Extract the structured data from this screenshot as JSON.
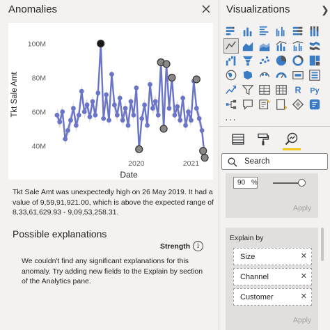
{
  "anomalies_pane": {
    "title": "Anomalies",
    "description": "Tkt Sale Amt was unexpectedly high on 26 May 2019. It had a value of 9,59,91,921.00, which is above the expected range of 8,33,61,629.93 - 9,09,53,258.31.",
    "explanations_heading": "Possible explanations",
    "strength_label": "Strength",
    "info_glyph": "i",
    "no_explanations_text": "We couldn't find any significant explanations for this anomaly. Try adding new fields to the Explain by section of the Analytics pane."
  },
  "chart_data": {
    "type": "line",
    "xlabel": "Date",
    "ylabel": "Tkt Sale Amt",
    "y_ticks": [
      "40M",
      "60M",
      "80M",
      "100M"
    ],
    "x_ticks": [
      "2020",
      "2021"
    ],
    "ylim": [
      32,
      108
    ],
    "xlim": [
      2018.45,
      2021.3
    ],
    "grid": false,
    "series": [
      {
        "color": "#6b75c7",
        "values": [
          [
            2018.55,
            58
          ],
          [
            2018.6,
            54
          ],
          [
            2018.65,
            60
          ],
          [
            2018.7,
            44
          ],
          [
            2018.75,
            49
          ],
          [
            2018.8,
            55
          ],
          [
            2018.85,
            62
          ],
          [
            2018.9,
            52
          ],
          [
            2018.95,
            58
          ],
          [
            2019.0,
            72
          ],
          [
            2019.05,
            60
          ],
          [
            2019.1,
            64
          ],
          [
            2019.15,
            57
          ],
          [
            2019.2,
            66
          ],
          [
            2019.25,
            58
          ],
          [
            2019.3,
            71
          ],
          [
            2019.35,
            100
          ],
          [
            2019.4,
            56
          ],
          [
            2019.45,
            70
          ],
          [
            2019.5,
            55
          ],
          [
            2019.55,
            82
          ],
          [
            2019.6,
            64
          ],
          [
            2019.65,
            58
          ],
          [
            2019.7,
            68
          ],
          [
            2019.75,
            55
          ],
          [
            2019.8,
            62
          ],
          [
            2019.85,
            52
          ],
          [
            2019.9,
            66
          ],
          [
            2019.95,
            58
          ],
          [
            2020.0,
            74
          ],
          [
            2020.05,
            38
          ],
          [
            2020.1,
            56
          ],
          [
            2020.15,
            64
          ],
          [
            2020.2,
            52
          ],
          [
            2020.25,
            76
          ],
          [
            2020.3,
            62
          ],
          [
            2020.35,
            66
          ],
          [
            2020.4,
            58
          ],
          [
            2020.45,
            89
          ],
          [
            2020.5,
            50
          ],
          [
            2020.55,
            88
          ],
          [
            2020.6,
            62
          ],
          [
            2020.65,
            80
          ],
          [
            2020.7,
            58
          ],
          [
            2020.75,
            63
          ],
          [
            2020.8,
            55
          ],
          [
            2020.85,
            68
          ],
          [
            2020.9,
            52
          ],
          [
            2020.95,
            60
          ],
          [
            2021.0,
            55
          ],
          [
            2021.05,
            78
          ],
          [
            2021.1,
            62
          ],
          [
            2021.15,
            56
          ],
          [
            2021.2,
            49
          ],
          [
            2021.25,
            33
          ]
        ],
        "anomalies": [
          {
            "x": 2019.35,
            "y": 100,
            "selected": true
          },
          {
            "x": 2020.05,
            "y": 38,
            "selected": false
          },
          {
            "x": 2020.45,
            "y": 89,
            "selected": false
          },
          {
            "x": 2020.5,
            "y": 50,
            "selected": false
          },
          {
            "x": 2020.55,
            "y": 88,
            "selected": false
          },
          {
            "x": 2020.65,
            "y": 80,
            "selected": false
          },
          {
            "x": 2021.1,
            "y": 79,
            "selected": false
          },
          {
            "x": 2021.25,
            "y": 33,
            "selected": false
          },
          {
            "x": 2021.22,
            "y": 37,
            "selected": false
          }
        ]
      }
    ]
  },
  "visualizations_pane": {
    "title": "Visualizations",
    "collapse_glyph": "❯",
    "more_glyph": "···",
    "search_placeholder": "Search",
    "percent_value": "90",
    "percent_unit": "%",
    "sensitivity_percent": 90,
    "apply_label": "Apply",
    "explain_by_label": "Explain by",
    "explain_fields": [
      "Size",
      "Channel",
      "Customer"
    ],
    "remove_glyph": "✕",
    "accent_color": "#f2c811",
    "visual_icons": [
      "stacked-bar-icon",
      "stacked-column-icon",
      "clustered-bar-icon",
      "clustered-column-icon",
      "100-stacked-bar-icon",
      "100-stacked-column-icon",
      "line-chart-icon",
      "area-chart-icon",
      "stacked-area-icon",
      "line-column-icon",
      "line-clustered-column-icon",
      "ribbon-chart-icon",
      "waterfall-icon",
      "funnel-icon",
      "scatter-icon",
      "pie-chart-icon",
      "donut-chart-icon",
      "treemap-icon",
      "map-icon",
      "filled-map-icon",
      "shape-map-icon",
      "gauge-icon",
      "card-icon",
      "multi-row-card-icon",
      "kpi-icon",
      "slicer-icon",
      "table-icon",
      "matrix-icon",
      "r-visual-icon",
      "python-visual-icon",
      "decomposition-tree-icon",
      "qa-icon",
      "smart-narrative-icon",
      "paginated-report-icon",
      "power-apps-icon",
      "power-automate-icon"
    ],
    "r_text": "R",
    "py_text": "Py"
  }
}
